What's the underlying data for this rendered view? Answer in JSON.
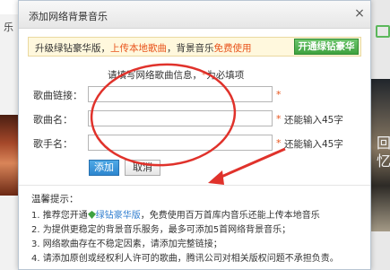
{
  "background": {
    "left_fragment_char": "乐",
    "right_fragment_text": "回忆"
  },
  "dialog": {
    "title": "添加网络背景音乐",
    "close_glyph": "×"
  },
  "promo": {
    "text_a": "升级绿钻豪华版，",
    "text_b": "上传本地歌曲",
    "text_c": "，背景音乐",
    "text_d": "免费使用",
    "button_label": "开通绿钻豪华"
  },
  "form": {
    "hint_text": "请填写网络歌曲信息，",
    "hint_star": "*",
    "hint_suffix": "为必填项",
    "fields": [
      {
        "label": "歌曲链接：",
        "value": "",
        "required": "*",
        "limit": ""
      },
      {
        "label": "歌曲名：",
        "value": "",
        "required": "*",
        "limit": "还能输入45字"
      },
      {
        "label": "歌手名：",
        "value": "",
        "required": "*",
        "limit": "还能输入45字"
      }
    ],
    "add_label": "添加",
    "cancel_label": "取消"
  },
  "tips": {
    "title": "温馨提示：",
    "line1_a": "1. 推荐您开通",
    "line1_link": "绿钻豪华版",
    "line1_b": "，免费使用百万首库内音乐还能上传本地音乐",
    "line2": "2. 为提供更稳定的背景音乐服务，最多可添加5首网络背景音乐；",
    "line3": "3. 网络歌曲存在不稳定因素，请添加完整链接；",
    "line4": "4. 请添加原创或经权利人许可的歌曲，腾讯公司对相关版权问题不承担负责。"
  },
  "colors": {
    "accent_orange": "#e8541c",
    "green_button": "#3fa23f",
    "blue_button": "#2d86cf",
    "annotation_red": "#e0322b"
  }
}
